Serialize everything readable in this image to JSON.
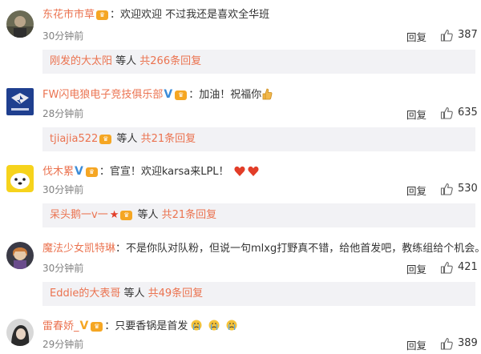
{
  "action_labels": {
    "reply": "回复"
  },
  "comments": [
    {
      "username": "东花市市草",
      "text": "：欢迎欢迎 不过我还是喜欢全华班",
      "time": "30分钟前",
      "likes": "387",
      "subreply": {
        "name": "刚发的大太阳",
        "etc": " 等人 ",
        "link": "共266条回复"
      }
    },
    {
      "username": "FW闪电狼电子竞技俱乐部",
      "text": "：加油！祝福你",
      "time": "28分钟前",
      "likes": "635",
      "subreply": {
        "name": "tjiajia522",
        "etc": " 等人 ",
        "link": "共21条回复"
      }
    },
    {
      "username": "伐木累",
      "text": "：官宣！欢迎karsa来LPL！",
      "time": "30分钟前",
      "likes": "530",
      "subreply": {
        "name": "呆头鹅一v一",
        "etc": " 等人 ",
        "link": "共21条回复"
      }
    },
    {
      "username": "魔法少女凯特琳",
      "text": "：不是你队对队粉，但说一句mlxg打野真不错，给他首发吧，教练组给个机会。",
      "time": "30分钟前",
      "likes": "421",
      "subreply": {
        "name": "Eddie的大表哥",
        "etc": " 等人 ",
        "link": "共49条回复"
      }
    },
    {
      "username": "雷春娇_",
      "text": "：只要香锅是首发",
      "time": "29分钟前",
      "likes": "389"
    }
  ]
}
